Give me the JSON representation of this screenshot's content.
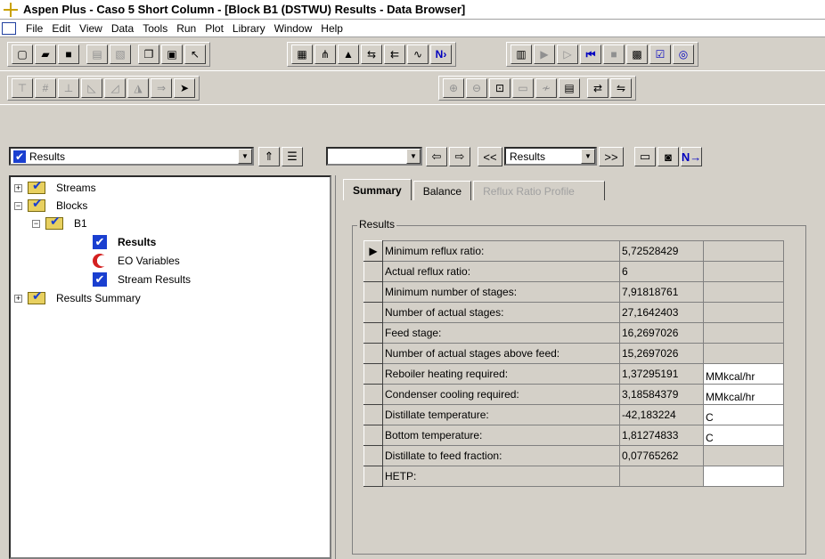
{
  "window": {
    "title": "Aspen Plus - Caso 5 Short Column - [Block B1 (DSTWU) Results - Data Browser]"
  },
  "menu": [
    "File",
    "Edit",
    "View",
    "Data",
    "Tools",
    "Run",
    "Plot",
    "Library",
    "Window",
    "Help"
  ],
  "navbar": {
    "form_combo": "Results",
    "history_combo": "",
    "prev_label": "<<",
    "next_label": ">>",
    "section_combo": "Results",
    "next_icon": "N→"
  },
  "tree": {
    "streams": "Streams",
    "blocks": "Blocks",
    "b1": "B1",
    "results": "Results",
    "eo_variables": "EO Variables",
    "stream_results": "Stream Results",
    "results_summary": "Results Summary"
  },
  "tabs": {
    "summary": "Summary",
    "balance": "Balance",
    "reflux_ratio_profile": "Reflux Ratio Profile"
  },
  "results": {
    "group_label": "Results",
    "rows": [
      {
        "label": "Minimum reflux ratio:",
        "value": "5,72528429",
        "unit": ""
      },
      {
        "label": "Actual reflux ratio:",
        "value": "6",
        "unit": ""
      },
      {
        "label": "Minimum number of stages:",
        "value": "7,91818761",
        "unit": ""
      },
      {
        "label": "Number of actual stages:",
        "value": "27,1642403",
        "unit": ""
      },
      {
        "label": "Feed stage:",
        "value": "16,2697026",
        "unit": ""
      },
      {
        "label": "Number of actual stages above feed:",
        "value": "15,2697026",
        "unit": ""
      },
      {
        "label": "Reboiler heating required:",
        "value": "1,37295191",
        "unit": "MMkcal/hr"
      },
      {
        "label": "Condenser cooling required:",
        "value": "3,18584379",
        "unit": "MMkcal/hr"
      },
      {
        "label": "Distillate temperature:",
        "value": "-42,183224",
        "unit": "C"
      },
      {
        "label": "Bottom temperature:",
        "value": "1,81274833",
        "unit": "C"
      },
      {
        "label": "Distillate to feed fraction:",
        "value": "0,07765262",
        "unit": ""
      },
      {
        "label": "HETP:",
        "value": "",
        "unit": ""
      }
    ]
  }
}
